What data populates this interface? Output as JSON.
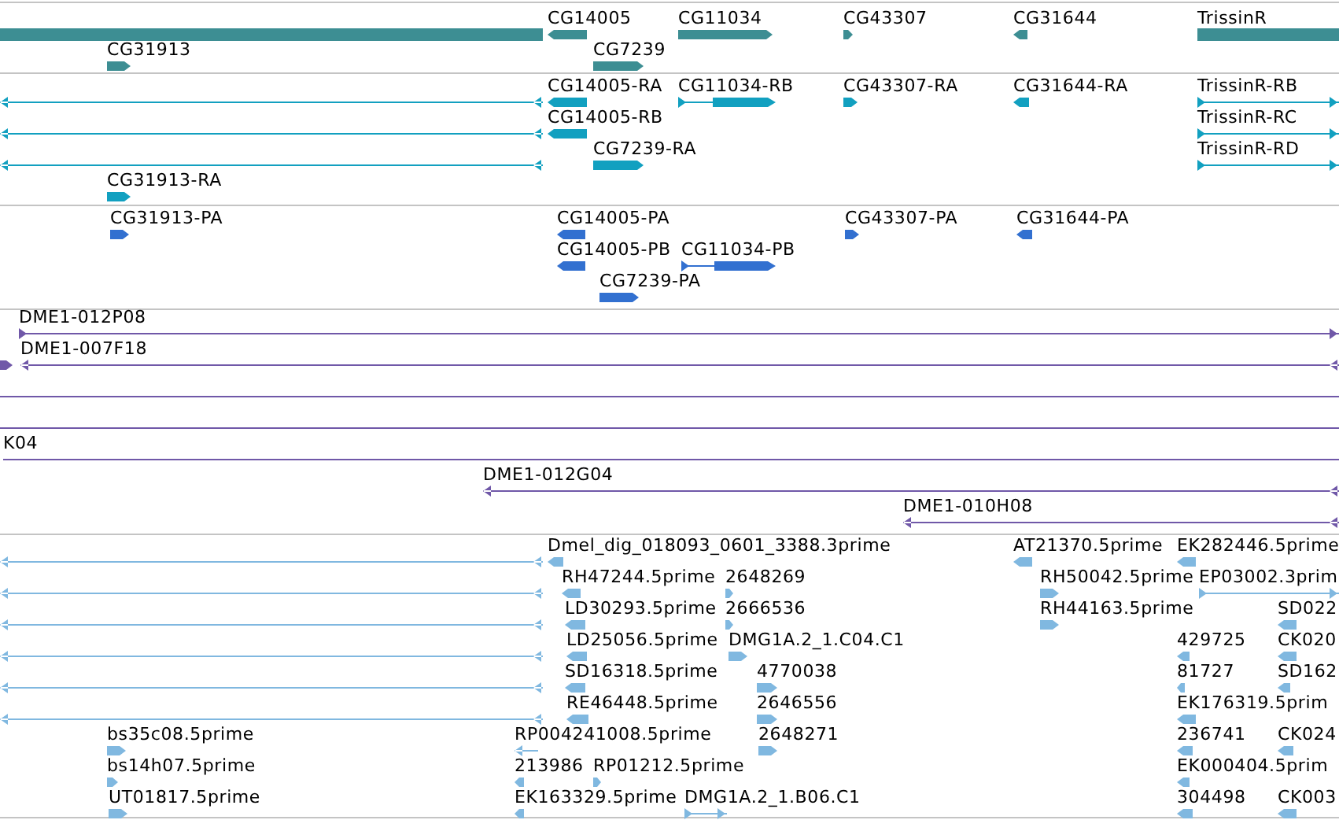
{
  "tracks": [
    {
      "color": "#3d8e93",
      "features": [
        {
          "kind": "bar"
        },
        {
          "label": "CG14005",
          "kind": "bar",
          "reverse": true
        },
        {
          "label": "CG11034",
          "kind": "bar",
          "reverse": false
        },
        {
          "label": "CG43307",
          "kind": "bar",
          "reverse": false
        },
        {
          "label": "CG31644",
          "kind": "bar",
          "reverse": true
        },
        {
          "label": "TrissinR",
          "kind": "bar"
        },
        {
          "label": "CG31913",
          "kind": "bar",
          "reverse": false
        },
        {
          "label": "CG7239",
          "kind": "bar",
          "reverse": false
        }
      ]
    },
    {
      "color": "#12a0c0",
      "features": [
        {
          "kind": "line",
          "reverse": true
        },
        {
          "label": "CG14005-RA",
          "kind": "bar",
          "reverse": true
        },
        {
          "label": "CG11034-RB",
          "kind": "exon",
          "reverse": false
        },
        {
          "label": "CG43307-RA",
          "kind": "bar",
          "reverse": false
        },
        {
          "label": "CG31644-RA",
          "kind": "bar",
          "reverse": true
        },
        {
          "label": "TrissinR-RB",
          "kind": "line",
          "reverse": false
        },
        {
          "kind": "line",
          "reverse": true
        },
        {
          "label": "CG14005-RB",
          "kind": "bar",
          "reverse": true
        },
        {
          "label": "TrissinR-RC",
          "kind": "line",
          "reverse": false
        },
        {
          "kind": "line",
          "reverse": true
        },
        {
          "label": "CG7239-RA",
          "kind": "bar",
          "reverse": false
        },
        {
          "label": "TrissinR-RD",
          "kind": "line",
          "reverse": false
        },
        {
          "label": "CG31913-RA",
          "kind": "bar",
          "reverse": false
        }
      ]
    },
    {
      "color": "#3270d0",
      "features": [
        {
          "label": "CG31913-PA",
          "kind": "bar",
          "reverse": false
        },
        {
          "label": "CG14005-PA",
          "kind": "bar",
          "reverse": true
        },
        {
          "label": "CG43307-PA",
          "kind": "bar",
          "reverse": false
        },
        {
          "label": "CG31644-PA",
          "kind": "bar",
          "reverse": true
        },
        {
          "label": "CG14005-PB",
          "kind": "bar",
          "reverse": true
        },
        {
          "label": "CG11034-PB",
          "kind": "exon",
          "reverse": false
        },
        {
          "label": "CG7239-PA",
          "kind": "bar",
          "reverse": false
        }
      ]
    },
    {
      "color": "#7058a8",
      "features": [
        {
          "label": "DME1-012P08",
          "kind": "line",
          "reverse": false
        },
        {
          "kind": "bar",
          "reverse": false
        },
        {
          "label": "DME1-007F18",
          "kind": "line",
          "reverse": true
        },
        {
          "kind": "line"
        },
        {
          "kind": "line"
        },
        {
          "label": "K04",
          "kind": "line"
        },
        {
          "label": "DME1-012G04",
          "kind": "line",
          "reverse": true
        },
        {
          "label": "DME1-010H08",
          "kind": "line",
          "reverse": true
        }
      ]
    },
    {
      "color": "#80b8e0",
      "features": [
        {
          "kind": "line",
          "reverse": true
        },
        {
          "kind": "line",
          "reverse": true
        },
        {
          "kind": "line",
          "reverse": true
        },
        {
          "kind": "line",
          "reverse": true
        },
        {
          "kind": "line",
          "reverse": true
        },
        {
          "kind": "line",
          "reverse": true
        },
        {
          "label": "Dmel_dig_018093_0601_3388.3prime",
          "kind": "bar",
          "reverse": true
        },
        {
          "label": "AT21370.5prime",
          "kind": "bar",
          "reverse": true
        },
        {
          "label": "EK282446.5prime",
          "kind": "bar",
          "reverse": true
        },
        {
          "label": "RH47244.5prime",
          "kind": "bar",
          "reverse": true
        },
        {
          "label": "2648269",
          "kind": "bar",
          "reverse": false
        },
        {
          "label": "RH50042.5prime",
          "kind": "bar",
          "reverse": false
        },
        {
          "label": "EP03002.3prim",
          "kind": "line",
          "reverse": false
        },
        {
          "label": "LD30293.5prime",
          "kind": "bar",
          "reverse": true
        },
        {
          "label": "2666536",
          "kind": "bar",
          "reverse": false
        },
        {
          "label": "RH44163.5prime",
          "kind": "bar",
          "reverse": false
        },
        {
          "label": "SD022",
          "kind": "bar",
          "reverse": true
        },
        {
          "label": "LD25056.5prime",
          "kind": "bar",
          "reverse": true
        },
        {
          "label": "DMG1A.2_1.C04.C1",
          "kind": "bar",
          "reverse": false
        },
        {
          "label": "429725",
          "kind": "bar",
          "reverse": true
        },
        {
          "label": "CK020",
          "kind": "bar",
          "reverse": true
        },
        {
          "label": "SD16318.5prime",
          "kind": "bar",
          "reverse": true
        },
        {
          "label": "4770038",
          "kind": "bar",
          "reverse": false
        },
        {
          "label": "81727",
          "kind": "bar",
          "reverse": true
        },
        {
          "label": "SD162",
          "kind": "bar",
          "reverse": true
        },
        {
          "label": "RE46448.5prime",
          "kind": "bar",
          "reverse": true
        },
        {
          "label": "2646556",
          "kind": "bar",
          "reverse": false
        },
        {
          "label": "EK176319.5prim",
          "kind": "bar",
          "reverse": true
        },
        {
          "label": "bs35c08.5prime",
          "kind": "bar",
          "reverse": false
        },
        {
          "label": "RP004241008.5prime",
          "kind": "line",
          "reverse": true
        },
        {
          "label": "2648271",
          "kind": "bar",
          "reverse": false
        },
        {
          "label": "236741",
          "kind": "bar",
          "reverse": true
        },
        {
          "label": "CK024",
          "kind": "bar",
          "reverse": true
        },
        {
          "label": "bs14h07.5prime",
          "kind": "bar",
          "reverse": false
        },
        {
          "label": "213986",
          "kind": "bar",
          "reverse": true
        },
        {
          "label": "RP01212.5prime",
          "kind": "bar",
          "reverse": false
        },
        {
          "label": "EK000404.5prim",
          "kind": "bar",
          "reverse": true
        },
        {
          "label": "UT01817.5prime",
          "kind": "bar",
          "reverse": false
        },
        {
          "label": "EK163329.5prime",
          "kind": "bar",
          "reverse": true
        },
        {
          "label": "DMG1A.2_1.B06.C1",
          "kind": "line",
          "reverse": false
        },
        {
          "label": "304498",
          "kind": "bar",
          "reverse": true
        },
        {
          "label": "CK003",
          "kind": "bar",
          "reverse": true
        }
      ]
    }
  ]
}
